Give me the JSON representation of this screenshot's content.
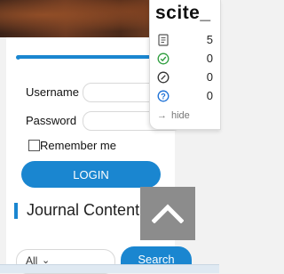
{
  "scite": {
    "logo": "scite_",
    "rows": [
      {
        "icon": "document-icon",
        "count": "5",
        "color": "#555555"
      },
      {
        "icon": "check-circle-icon",
        "count": "0",
        "color": "#2e9e3e"
      },
      {
        "icon": "slash-circle-icon",
        "count": "0",
        "color": "#333333"
      },
      {
        "icon": "question-circle-icon",
        "count": "0",
        "color": "#1a6fd6"
      }
    ],
    "hide_label": "hide",
    "hide_arrow": "→"
  },
  "login": {
    "username_label": "Username",
    "password_label": "Password",
    "remember_label": "Remember me",
    "login_button": "LOGIN"
  },
  "journal": {
    "section_title": "Journal Content",
    "filter_value": "All",
    "filter_caret": "⌄",
    "search_button": "Search"
  },
  "colors": {
    "accent": "#1a86d0",
    "scroll_top_bg": "#8c8c8c"
  }
}
